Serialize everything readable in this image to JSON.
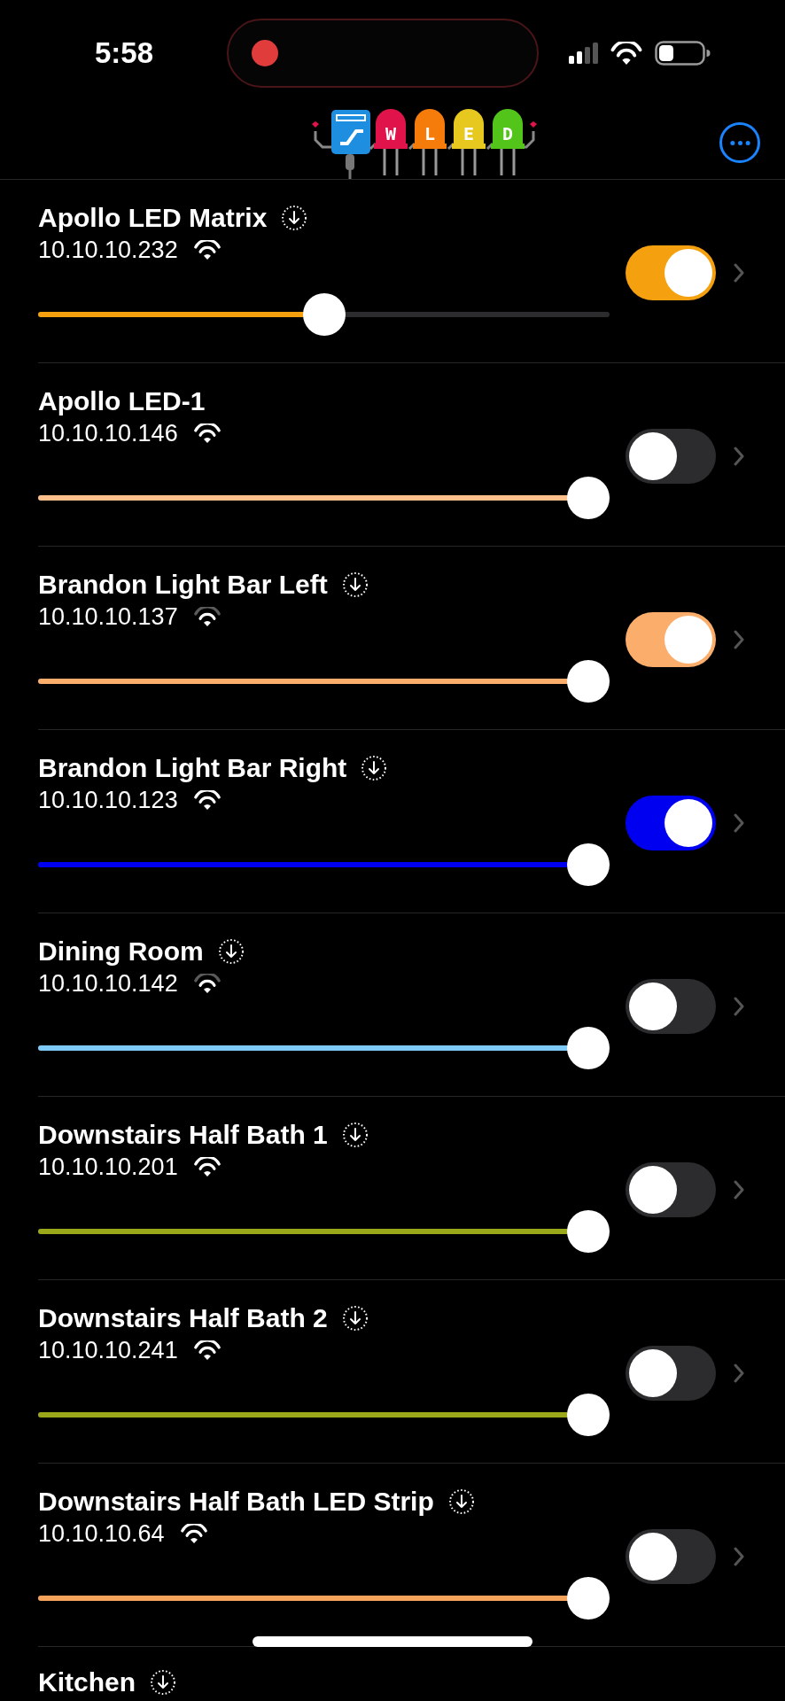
{
  "status_bar": {
    "time": "5:58",
    "recording": true
  },
  "logo": {
    "letters": [
      "W",
      "L",
      "E",
      "D"
    ]
  },
  "devices": [
    {
      "name": "Apollo LED Matrix",
      "update_available": true,
      "ip": "10.10.10.232",
      "weak_signal": false,
      "on": true,
      "color": "#f5a00f",
      "level": 0.5
    },
    {
      "name": "Apollo LED-1",
      "update_available": false,
      "ip": "10.10.10.146",
      "weak_signal": false,
      "on": false,
      "color": "#fdbf8c",
      "level": 1
    },
    {
      "name": "Brandon Light Bar Left",
      "update_available": true,
      "ip": "10.10.10.137",
      "weak_signal": true,
      "on": true,
      "color": "#fbae6c",
      "level": 1
    },
    {
      "name": "Brandon Light Bar Right",
      "update_available": true,
      "ip": "10.10.10.123",
      "weak_signal": false,
      "on": true,
      "color": "#0000f0",
      "level": 1
    },
    {
      "name": "Dining Room",
      "update_available": true,
      "ip": "10.10.10.142",
      "weak_signal": true,
      "on": false,
      "color": "#7ecbf7",
      "level": 1
    },
    {
      "name": "Downstairs Half Bath 1",
      "update_available": true,
      "ip": "10.10.10.201",
      "weak_signal": false,
      "on": false,
      "color": "#9aa81a",
      "level": 1
    },
    {
      "name": "Downstairs Half Bath 2",
      "update_available": true,
      "ip": "10.10.10.241",
      "weak_signal": false,
      "on": false,
      "color": "#9aa81a",
      "level": 1
    },
    {
      "name": "Downstairs Half Bath LED Strip",
      "update_available": true,
      "ip": "10.10.10.64",
      "weak_signal": false,
      "on": false,
      "color": "#f5a25a",
      "level": 1
    },
    {
      "name": "Kitchen",
      "update_available": true
    }
  ]
}
